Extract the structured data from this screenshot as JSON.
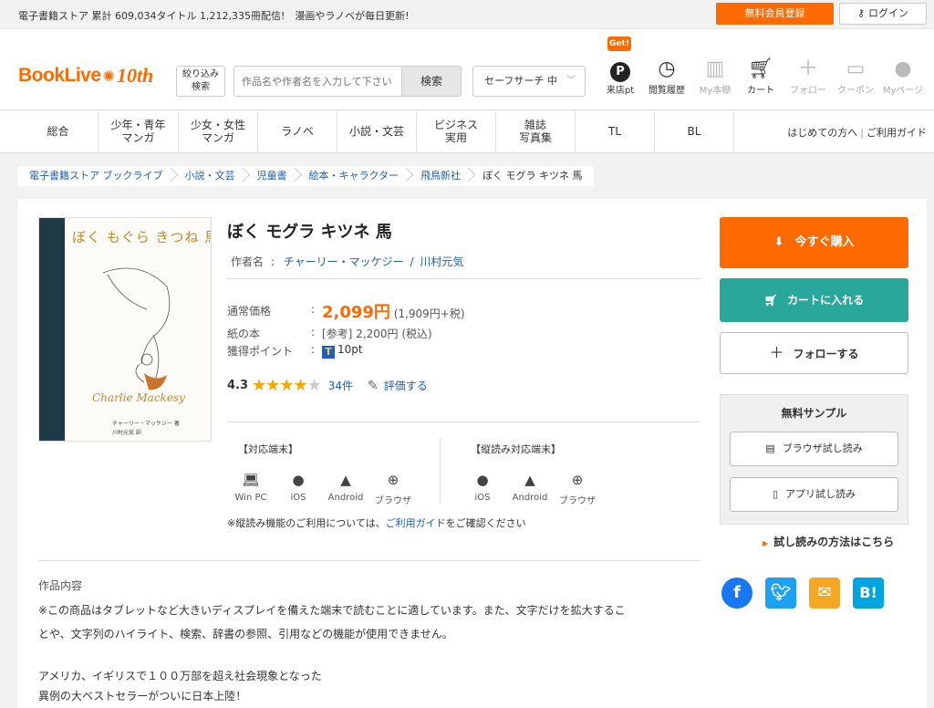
{
  "topbar": {
    "tagline": "電子書籍ストア 累計 609,034タイトル 1,212,335冊配信!　漫画やラノベが毎日更新!",
    "register": "無料会員登録",
    "login": "ログイン"
  },
  "header": {
    "logo_text": "BookLive",
    "logo_anniversary": "10th",
    "filter_label_1": "絞り込み",
    "filter_label_2": "検索",
    "search_placeholder": "作品名や作者名を入力して下さい",
    "search_button": "検索",
    "safe_search": "セーフサーチ 中",
    "get_badge": "Get!",
    "icons": [
      {
        "name": "pt-icon",
        "label": "来店pt"
      },
      {
        "name": "history-icon",
        "label": "閲覧履歴"
      },
      {
        "name": "bookshelf-icon",
        "label": "My本棚"
      },
      {
        "name": "cart-icon",
        "label": "カート"
      },
      {
        "name": "plus-icon",
        "label": "フォロー"
      },
      {
        "name": "coupon-icon",
        "label": "クーポン"
      },
      {
        "name": "user-icon",
        "label": "Myページ"
      }
    ]
  },
  "nav": {
    "items": [
      {
        "l1": "総合",
        "l2": ""
      },
      {
        "l1": "少年・青年",
        "l2": "マンガ"
      },
      {
        "l1": "少女・女性",
        "l2": "マンガ"
      },
      {
        "l1": "ラノベ",
        "l2": ""
      },
      {
        "l1": "小説・文芸",
        "l2": ""
      },
      {
        "l1": "ビジネス",
        "l2": "実用"
      },
      {
        "l1": "雑誌",
        "l2": "写真集"
      },
      {
        "l1": "TL",
        "l2": ""
      },
      {
        "l1": "BL",
        "l2": ""
      }
    ],
    "first_time": "はじめての方へ",
    "guide": "ご利用ガイド"
  },
  "breadcrumb": [
    "電子書籍ストア ブックライブ",
    "小説・文芸",
    "児童書",
    "絵本・キャラクター",
    "飛鳥新社",
    "ぼく モグラ キツネ 馬"
  ],
  "cover": {
    "title": "ぼく もぐら きつね 馬",
    "signature": "Charlie Mackesy",
    "author": "チャーリー・マッケジー 著",
    "translator": "川村元気 訳"
  },
  "book": {
    "title": "ぼく モグラ キツネ 馬",
    "author_label": "作者名",
    "author_1": "チャーリー・マッケジー",
    "author_sep": "/",
    "author_2": "川村元気",
    "price_label": "通常価格",
    "price": "2,099円",
    "price_tax": "(1,909円+税)",
    "paper_label": "紙の本",
    "paper_price": "[参考] 2,200円 (税込)",
    "points_label": "獲得ポイント",
    "points": "10pt",
    "colon": ":",
    "rating": "4.3",
    "rating_count": "34件",
    "rate_link": "評価する"
  },
  "devices": {
    "head_left": "【対応端末】",
    "head_right": "【縦読み対応端末】",
    "left": [
      "Win PC",
      "iOS",
      "Android",
      "ブラウザ"
    ],
    "right": [
      "iOS",
      "Android",
      "ブラウザ"
    ],
    "note_pre": "※縦読み機能のご利用については、",
    "note_link": "ご利用ガイド",
    "note_post": "をご確認ください"
  },
  "actions": {
    "buy_now": "今すぐ購入",
    "add_cart": "カートに入れる",
    "follow": "フォローする",
    "sample_title": "無料サンプル",
    "browser_sample": "ブラウザ試し読み",
    "app_sample": "アプリ試し読み",
    "howto": "試し読みの方法はこちら"
  },
  "social": {
    "facebook": "f",
    "hatena": "B!"
  },
  "description": {
    "head": "作品内容",
    "line1": "※この商品はタブレットなど大きいディスプレイを備えた端末で読むことに適しています。また、文字だけを拡大するこ",
    "line2": "とや、文字列のハイライト、検索、辞書の参照、引用などの機能が使用できません。",
    "line3": "アメリカ、イギリスで１００万部を超え社会現象となった",
    "line4": "異例の大ベストセラーがついに日本上陸！"
  },
  "colors": {
    "accent": "#ff6a00",
    "teal": "#2aa79b",
    "link": "#1f5fb3"
  }
}
